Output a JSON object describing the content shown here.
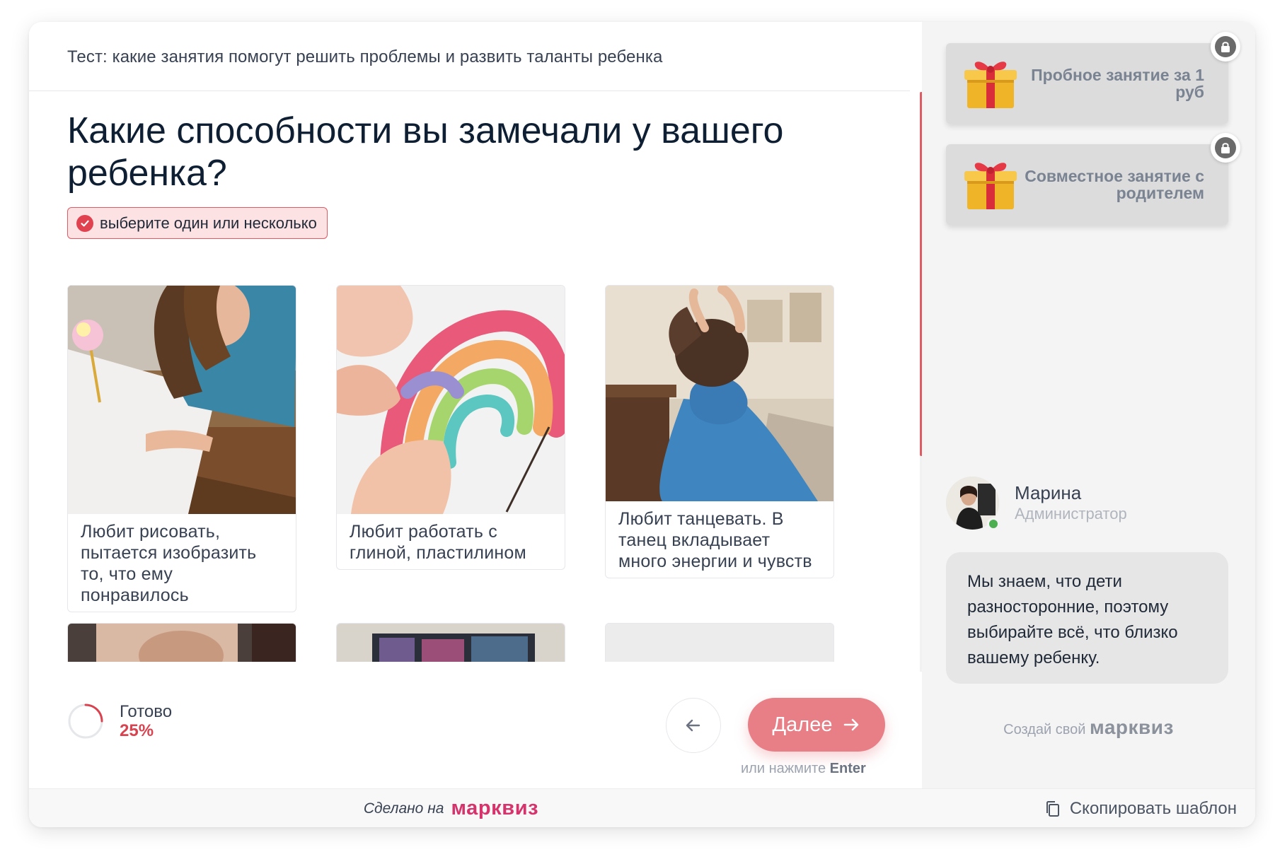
{
  "quiz": {
    "title": "Тест: какие занятия помогут решить проблемы и развить таланты ребенка",
    "question": "Какие способности вы замечали у вашего ребенка?",
    "hint": "выберите один или несколько"
  },
  "answers": [
    {
      "caption": "Любит рисовать, пытается изобразить то, что ему понравилось",
      "image_icon": "girl-drawing-photo"
    },
    {
      "caption": "Любит работать с глиной, пластилином",
      "image_icon": "plasticine-rainbow-photo"
    },
    {
      "caption": "Любит танцевать. В танец вкладывает много энергии и чувств",
      "image_icon": "girl-dancing-photo"
    }
  ],
  "progress": {
    "label": "Готово",
    "value": "25%",
    "fraction": 0.25
  },
  "navigation": {
    "next_label": "Далее",
    "enter_hint_prefix": "или нажмите",
    "enter_hint_key": "Enter"
  },
  "bonuses": [
    {
      "label": "Пробное занятие за 1 руб",
      "locked": true
    },
    {
      "label": "Совместное занятие с родителем",
      "locked": true
    }
  ],
  "manager": {
    "name": "Марина",
    "role": "Администратор",
    "message": "Мы знаем, что дети разносторонние, поэтому выбирайте всё, что близко вашему ребенку."
  },
  "sidebar_footer": {
    "prefix": "Создай свой",
    "brand": "марквиз"
  },
  "footer": {
    "made_on": "Сделано на",
    "brand": "марквиз",
    "copy_label": "Скопировать шаблон"
  },
  "colors": {
    "accent": "#e87f86",
    "accent_dark": "#d9434f",
    "brand_pink": "#d6336c",
    "sidebar_bg": "#f4f4f4"
  }
}
